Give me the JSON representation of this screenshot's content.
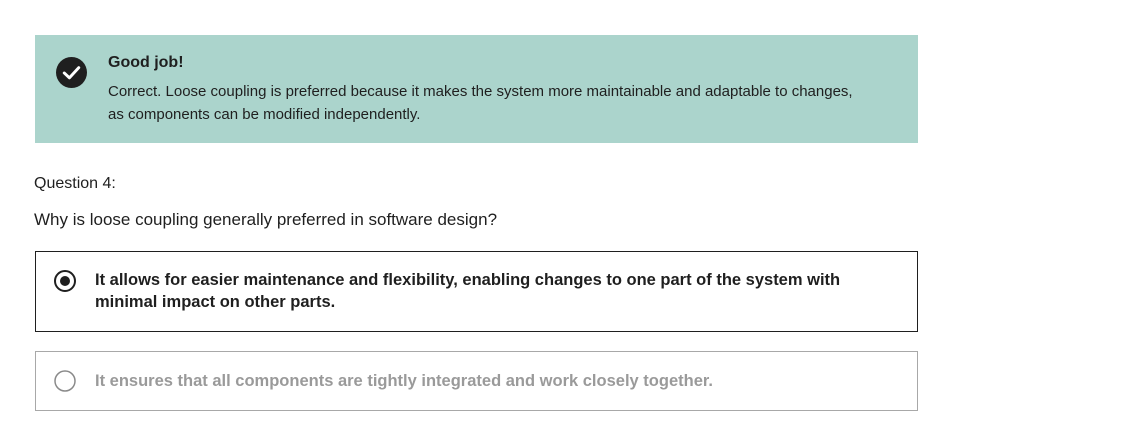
{
  "feedback": {
    "status": "correct",
    "icon": "checkmark-circle-icon",
    "title": "Good job!",
    "message": "Correct. Loose coupling is preferred because it makes the system more maintainable and adaptable to changes, as components can be modified independently.",
    "background_color": "#abd4cc"
  },
  "question": {
    "number_label": "Question 4:",
    "prompt": "Why is loose coupling generally preferred in software design?",
    "options": [
      {
        "label": "It allows for easier maintenance and flexibility, enabling changes to one part of the system with minimal impact on other parts.",
        "selected": true
      },
      {
        "label": "It ensures that all components are tightly integrated and work closely together.",
        "selected": false
      }
    ]
  }
}
